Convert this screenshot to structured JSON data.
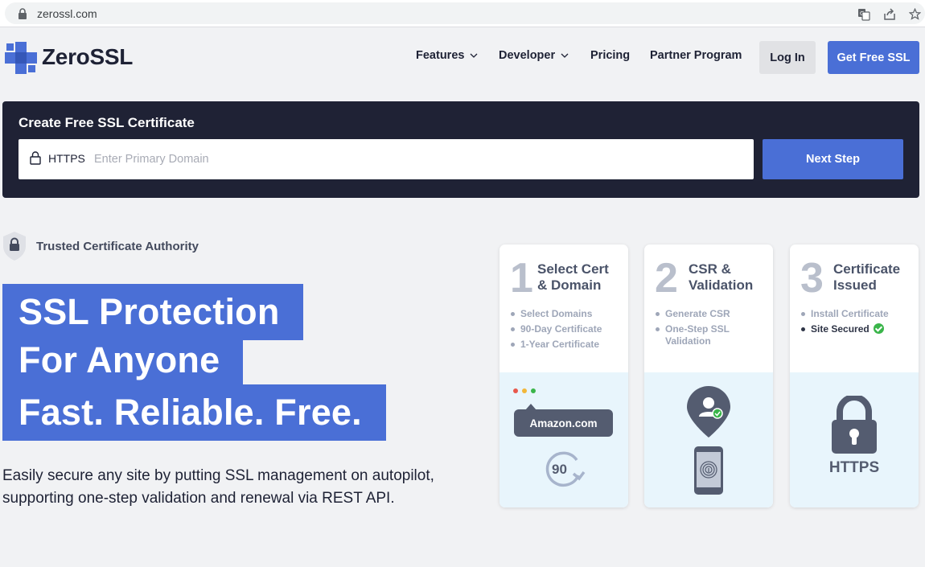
{
  "browser": {
    "url": "zerossl.com",
    "lock_icon": "lock-icon",
    "translate_icon": "translate-icon",
    "share_icon": "share-icon",
    "star_icon": "star-icon"
  },
  "nav": {
    "brand": "ZeroSSL",
    "logo_icon": "zerossl-logo-icon",
    "items": [
      {
        "label": "Features",
        "has_dropdown": true
      },
      {
        "label": "Developer",
        "has_dropdown": true
      },
      {
        "label": "Pricing",
        "has_dropdown": false
      },
      {
        "label": "Partner Program",
        "has_dropdown": false
      }
    ],
    "login_label": "Log In",
    "cta_label": "Get Free SSL"
  },
  "create": {
    "title": "Create Free SSL Certificate",
    "prefix": "HTTPS",
    "placeholder": "Enter Primary Domain",
    "value": "",
    "next_label": "Next Step"
  },
  "trust": {
    "label": "Trusted Certificate Authority",
    "icon": "shield-lock-icon"
  },
  "hero": {
    "lines": [
      "SSL Protection",
      "For Anyone",
      "Fast. Reliable. Free."
    ],
    "description": "Easily secure any site by putting SSL management on autopilot, supporting one-step validation and renewal via REST API."
  },
  "steps": [
    {
      "number": "1",
      "title_lines": [
        "Select Cert",
        "& Domain"
      ],
      "items": [
        {
          "label": "Select Domains",
          "active": false
        },
        {
          "label": "90-Day Certificate",
          "active": false
        },
        {
          "label": "1-Year Certificate",
          "active": false
        }
      ],
      "illustration": {
        "site_label": "Amazon.com",
        "renew_days": "90"
      }
    },
    {
      "number": "2",
      "title_lines": [
        "CSR &",
        "Validation"
      ],
      "items": [
        {
          "label": "Generate CSR",
          "active": false
        },
        {
          "label": "One-Step SSL Validation",
          "active": false
        }
      ],
      "illustration": {
        "icons": [
          "user-pin-icon",
          "fingerprint-phone-icon"
        ]
      }
    },
    {
      "number": "3",
      "title_lines": [
        "Certificate",
        "Issued"
      ],
      "items": [
        {
          "label": "Install Certificate",
          "active": false
        },
        {
          "label": "Site Secured",
          "active": true
        }
      ],
      "illustration": {
        "label": "HTTPS"
      }
    }
  ],
  "colors": {
    "accent": "#4a6fd6",
    "dark_panel": "#1f2235",
    "page_bg": "#f1f2f4",
    "card_bottom": "#e8f5fc",
    "success": "#3ab54a"
  }
}
